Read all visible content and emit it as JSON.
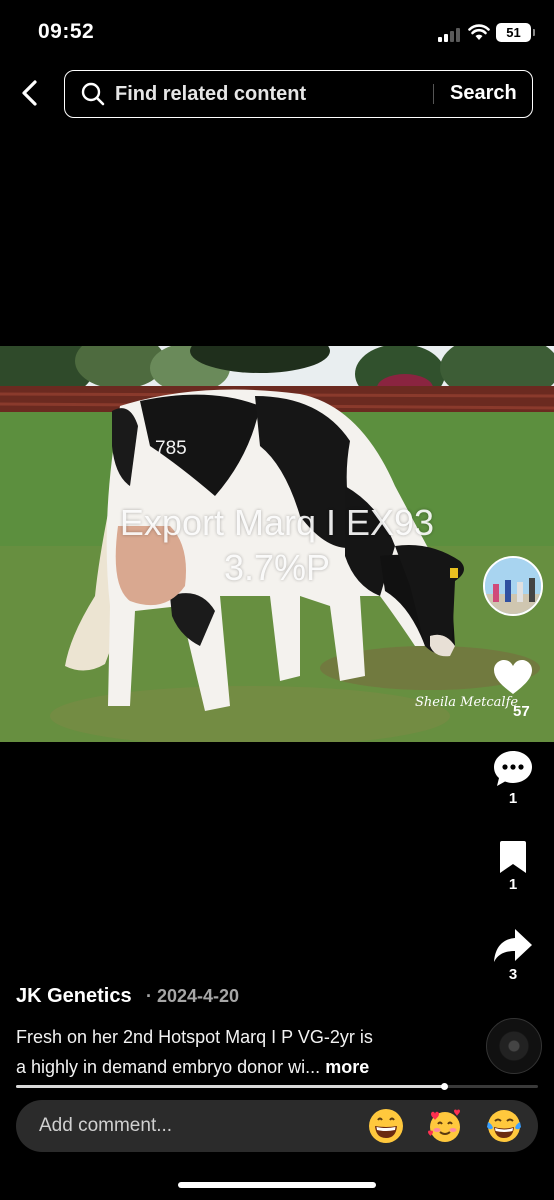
{
  "status_bar": {
    "time": "09:52",
    "battery": "51"
  },
  "search": {
    "placeholder": "Find related content",
    "button_label": "Search"
  },
  "video": {
    "overlay_line1": "Export Marq I EX93",
    "overlay_line2": "3.7%P",
    "watermark": "Sheila Metcalfe",
    "cow_tag": "785"
  },
  "actions": {
    "like_count": "57",
    "comment_count": "1",
    "save_count": "1",
    "share_count": "3"
  },
  "post": {
    "author": "JK Genetics",
    "date": "· 2024-4-20",
    "caption_line1": "Fresh on her 2nd Hotspot Marq I P VG-2yr is",
    "caption_line2": "a highly in demand embryo donor wi...",
    "more_label": "more"
  },
  "playback": {
    "progress_fraction": 0.82
  },
  "comment": {
    "placeholder": "Add comment...",
    "emojis": [
      "grinning-face",
      "smiling-face-with-hearts",
      "face-with-tears-of-joy"
    ]
  },
  "colors": {
    "background": "#000000",
    "comment_bar": "#2b2b2b",
    "secondary_text": "#a6a6a6"
  }
}
